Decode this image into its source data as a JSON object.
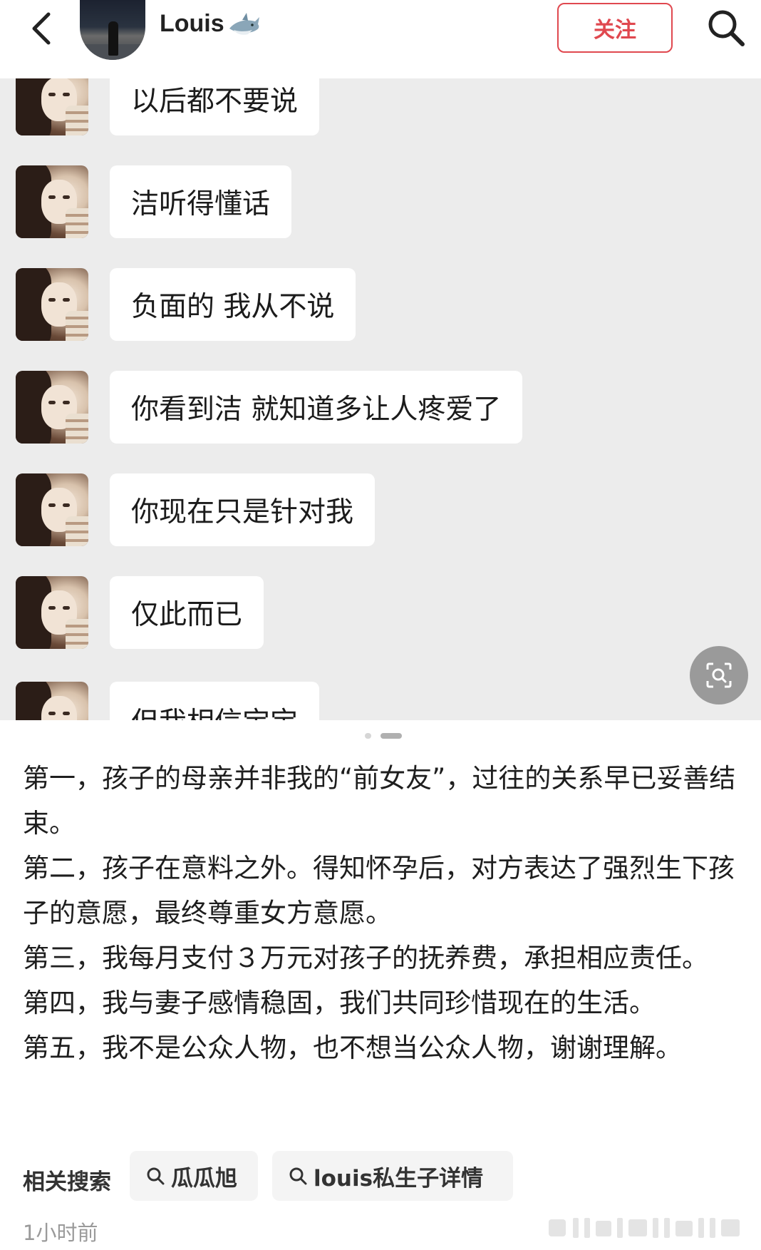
{
  "header": {
    "username": "Louis",
    "follow_label": "关注",
    "icons": {
      "back": "chevron-left-icon",
      "badge": "shark-icon",
      "search": "search-icon"
    }
  },
  "chat": {
    "messages": [
      "以后都不要说",
      "洁听得懂话",
      "负面的 我从不说",
      "你看到洁 就知道多让人疼爱了",
      "你现在只是针对我",
      "仅此而已",
      "但我相信宝宝"
    ]
  },
  "post": {
    "paragraphs": [
      "第一，孩子的母亲并非我的“前女友”，过往的关系早已妥善结束。",
      "第二，孩子在意料之外。得知怀孕后，对方表达了强烈生下孩子的意愿，最终尊重女方意愿。",
      "第三，我每月支付３万元对孩子的抚养费，承担相应责任。",
      "第四，我与妻子感情稳固，我们共同珍惜现在的生活。",
      "第五，我不是公众人物，也不想当公众人物，谢谢理解。"
    ]
  },
  "related": {
    "label": "相关搜索",
    "chips": [
      "瓜瓜旭",
      "louis私生子详情"
    ]
  },
  "meta": {
    "time": "1小时前"
  },
  "colors": {
    "accent": "#e0484f",
    "chat_bg": "#ececec"
  }
}
